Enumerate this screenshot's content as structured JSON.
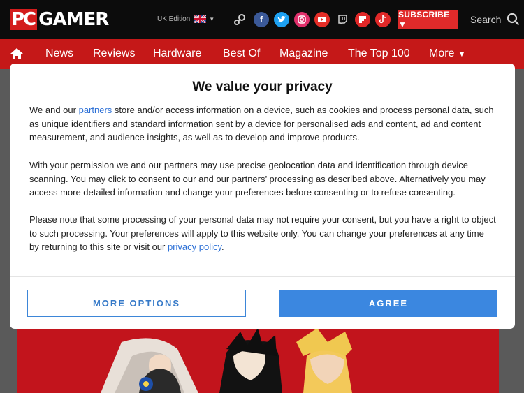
{
  "header": {
    "logo_pc": "PC",
    "logo_gamer": "GAMER",
    "edition_label": "UK Edition",
    "subscribe_label": "SUBSCRIBE ▼",
    "search_label": "Search",
    "social_icons": [
      "steam-icon",
      "facebook-icon",
      "twitter-icon",
      "instagram-icon",
      "youtube-icon",
      "twitch-icon",
      "flipboard-icon",
      "tiktok-icon"
    ]
  },
  "nav": {
    "items": [
      "News",
      "Reviews",
      "Hardware",
      "Best Of",
      "Magazine",
      "The Top 100",
      "More"
    ]
  },
  "consent": {
    "title": "We value your privacy",
    "p1_before": "We and our ",
    "p1_link": "partners",
    "p1_after": " store and/or access information on a device, such as cookies and process personal data, such as unique identifiers and standard information sent by a device for personalised ads and content, ad and content measurement, and audience insights, as well as to develop and improve products.",
    "p2": "With your permission we and our partners may use precise geolocation data and identification through device scanning. You may click to consent to our and our partners’ processing as described above. Alternatively you may access more detailed information and change your preferences before consenting or to refuse consenting.",
    "p3_before": "Please note that some processing of your personal data may not require your consent, but you have a right to object to such processing. Your preferences will apply to this website only. You can change your preferences at any time by returning to this site or visit our ",
    "p3_link": "privacy policy",
    "p3_after": ".",
    "more_options_label": "MORE OPTIONS",
    "agree_label": "AGREE"
  },
  "colors": {
    "brand_red": "#d31c1c",
    "nav_red": "#c51818",
    "agree_blue": "#3b87e0",
    "link_blue": "#2b6fd6"
  }
}
